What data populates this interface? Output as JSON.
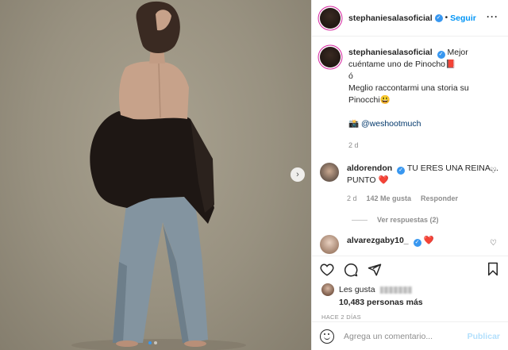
{
  "post": {
    "username": "stephaniesalasoficial",
    "verified_mark": "✓",
    "separator": "•",
    "follow_label": "Seguir",
    "more_label": "···"
  },
  "caption": {
    "username": "stephaniesalasoficial",
    "text_line1": "Mejor cuéntame uno de Pinocho📕",
    "text_line2": "ó",
    "text_line3": "Meglio raccontarmi una storia su Pinocchi😃",
    "credit_icon": "📸",
    "credit_mention": "@weshootmuch",
    "age": "2 d"
  },
  "comments": [
    {
      "username": "aldorendon",
      "text": "TU ERES UNA REINA… PUNTO",
      "emoji": "❤️",
      "age": "2 d",
      "likes": "142 Me gusta",
      "reply_label": "Responder",
      "view_replies": "Ver respuestas (2)"
    },
    {
      "username": "alvarezgaby10_",
      "text": "",
      "emoji": "❤️"
    }
  ],
  "likes": {
    "prefix": "Les gusta",
    "count_text": "10,483 personas más"
  },
  "timestamp": "HACE 2 DÍAS",
  "comment_box": {
    "placeholder": "Agrega un comentario...",
    "post_label": "Publicar"
  },
  "media": {
    "carousel_total": 2,
    "carousel_active": 1,
    "next_arrow": "›"
  },
  "icons": [
    "heart-icon",
    "comment-icon",
    "share-icon",
    "bookmark-icon",
    "emoji-icon",
    "chevron-right-icon",
    "more-icon",
    "verified-icon"
  ],
  "colors": {
    "accent": "#0095f6",
    "verified": "#3897f0",
    "heart": "#e0245e",
    "muted": "#8e8e8e"
  }
}
